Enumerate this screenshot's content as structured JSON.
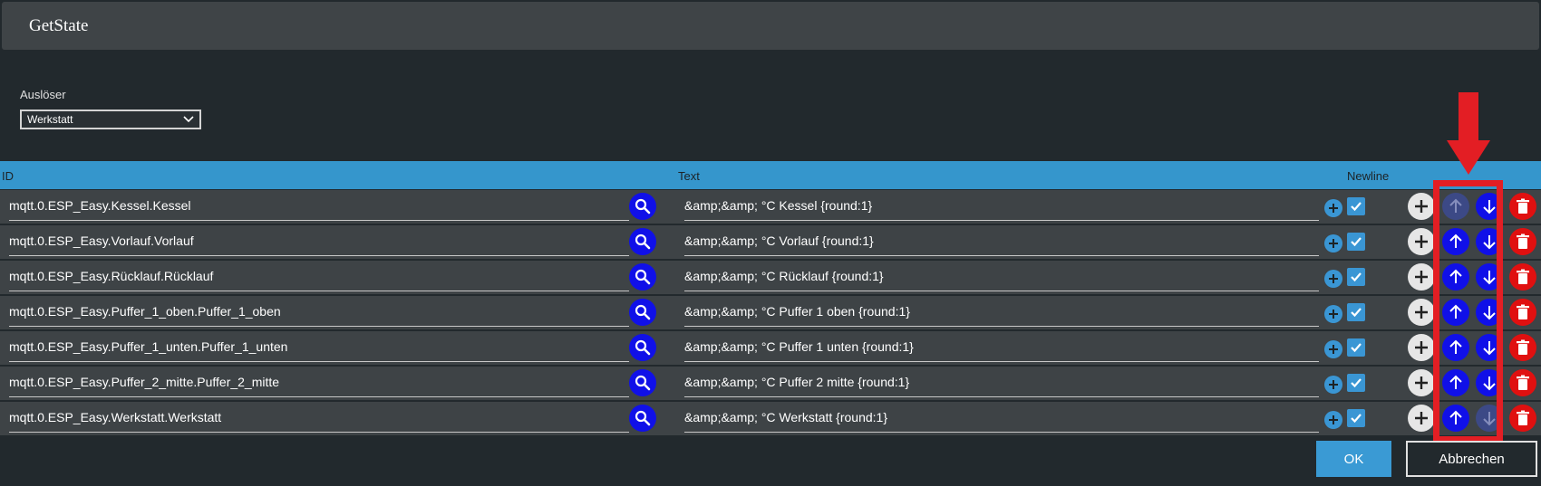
{
  "dialog": {
    "title": "GetState"
  },
  "trigger": {
    "label": "Auslöser",
    "selected": "Werkstatt"
  },
  "table": {
    "headers": {
      "id": "ID",
      "text": "Text",
      "newline": "Newline"
    },
    "rows": [
      {
        "id": "mqtt.0.ESP_Easy.Kessel.Kessel",
        "text": "&amp;&amp; °C Kessel {round:1}",
        "newline": true,
        "up_enabled": false,
        "down_enabled": true
      },
      {
        "id": "mqtt.0.ESP_Easy.Vorlauf.Vorlauf",
        "text": "&amp;&amp; °C Vorlauf {round:1}",
        "newline": true,
        "up_enabled": true,
        "down_enabled": true
      },
      {
        "id": "mqtt.0.ESP_Easy.Rücklauf.Rücklauf",
        "text": "&amp;&amp; °C Rücklauf {round:1}",
        "newline": true,
        "up_enabled": true,
        "down_enabled": true
      },
      {
        "id": "mqtt.0.ESP_Easy.Puffer_1_oben.Puffer_1_oben",
        "text": "&amp;&amp; °C Puffer 1 oben {round:1}",
        "newline": true,
        "up_enabled": true,
        "down_enabled": true
      },
      {
        "id": "mqtt.0.ESP_Easy.Puffer_1_unten.Puffer_1_unten",
        "text": "&amp;&amp; °C Puffer 1 unten {round:1}",
        "newline": true,
        "up_enabled": true,
        "down_enabled": true
      },
      {
        "id": "mqtt.0.ESP_Easy.Puffer_2_mitte.Puffer_2_mitte",
        "text": "&amp;&amp; °C Puffer 2 mitte {round:1}",
        "newline": true,
        "up_enabled": true,
        "down_enabled": true
      },
      {
        "id": "mqtt.0.ESP_Easy.Werkstatt.Werkstatt",
        "text": "&amp;&amp; °C Werkstatt {round:1}",
        "newline": true,
        "up_enabled": true,
        "down_enabled": false
      }
    ]
  },
  "footer": {
    "ok_label": "OK",
    "cancel_label": "Abbrechen"
  },
  "colors": {
    "accent": "#3596cc",
    "button_blue": "#1010e8",
    "delete_red": "#e01010",
    "annotation_red": "#e31e24"
  },
  "icons": {
    "search": "search-icon",
    "plus": "plus-icon",
    "check": "check-icon",
    "up": "arrow-up-icon",
    "down": "arrow-down-icon",
    "delete": "trash-icon"
  }
}
